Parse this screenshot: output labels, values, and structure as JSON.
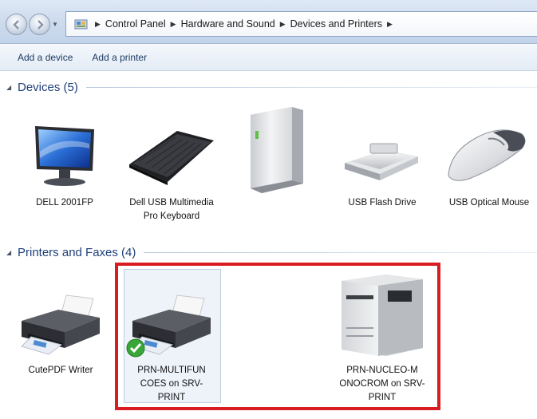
{
  "breadcrumb": [
    "Control Panel",
    "Hardware and Sound",
    "Devices and Printers"
  ],
  "toolbar": {
    "add_device": "Add a device",
    "add_printer": "Add a printer"
  },
  "groups": {
    "devices": {
      "title": "Devices (5)",
      "items": [
        {
          "name": "DELL 2001FP",
          "icon": "monitor-icon"
        },
        {
          "name": "Dell USB Multimedia Pro Keyboard",
          "icon": "keyboard-icon"
        },
        {
          "name": "",
          "icon": "computer-tower-icon"
        },
        {
          "name": "USB Flash Drive",
          "icon": "usb-drive-icon"
        },
        {
          "name": "USB Optical Mouse",
          "icon": "mouse-icon"
        }
      ]
    },
    "printers": {
      "title": "Printers and Faxes (4)",
      "items": [
        {
          "name": "CutePDF Writer",
          "icon": "printer-icon"
        },
        {
          "name": "PRN-MULTIFUN COES on SRV-PRINT",
          "icon": "printer-icon",
          "default": true
        },
        {
          "name": "PRN-NUCLEO-M ONOCROM on SRV-PRINT",
          "icon": "laser-printer-icon"
        }
      ]
    }
  },
  "colors": {
    "highlight_border": "#d81c22",
    "group_title": "#1e3f7a"
  }
}
